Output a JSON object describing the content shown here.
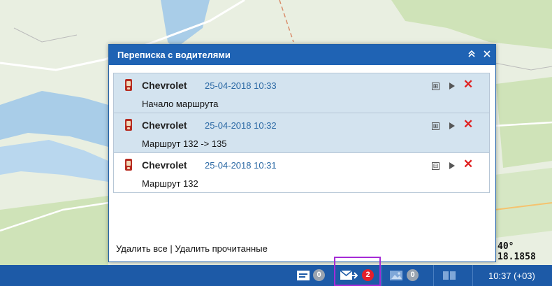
{
  "map": {
    "coordinate_text": "40° 18.1858"
  },
  "dialog": {
    "title": "Переписка с водителями",
    "collapse_icon": "double-chevron-up",
    "close_icon": "close",
    "messages": [
      {
        "sender": "Chevrolet",
        "date": "25-04-2018 10:33",
        "text": "Начало маршрута",
        "state": "unread",
        "expand_symbol": "⊞"
      },
      {
        "sender": "Chevrolet",
        "date": "25-04-2018 10:32",
        "text": "Маршрут 132 -> 135",
        "state": "unread",
        "expand_symbol": "⊞"
      },
      {
        "sender": "Chevrolet",
        "date": "25-04-2018 10:31",
        "text": "Маршрут 132",
        "state": "read",
        "expand_symbol": "⊟"
      }
    ],
    "footer": {
      "delete_all": "Удалить все",
      "separator": " | ",
      "delete_read": "Удалить прочитанные"
    }
  },
  "taskbar": {
    "notes_count": "0",
    "messages_count": "2",
    "images_count": "0",
    "time": "10:37 (+03)"
  },
  "colors": {
    "header": "#1f63b4",
    "taskbar": "#1d5aa7",
    "unread_bg": "#d3e3ef",
    "badge_red": "#e41f2b",
    "date": "#2a68a4",
    "highlight": "#a52bd6"
  }
}
